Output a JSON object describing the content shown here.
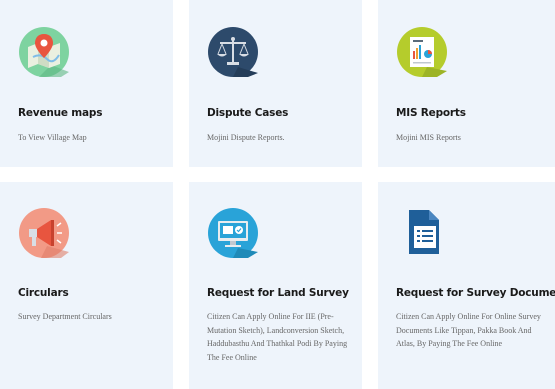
{
  "cards": [
    {
      "title": "Revenue maps",
      "description": "To View Village Map",
      "icon": "map-pin-icon"
    },
    {
      "title": "Dispute Cases",
      "description": "Mojini Dispute Reports.",
      "icon": "scales-icon"
    },
    {
      "title": "MIS Reports",
      "description": "Mojini MIS Reports",
      "icon": "report-chart-icon"
    },
    {
      "title": "Circulars",
      "description": "Survey Department Circulars",
      "icon": "megaphone-icon"
    },
    {
      "title": "Request for Land Survey",
      "description": "Citizen Can Apply Online For IIE (Pre-Mutation Sketch), Landconversion Sketch, Haddubasthu And Thathkal Podi By Paying The Fee Online",
      "icon": "monitor-check-icon"
    },
    {
      "title": "Request for Survey Documents",
      "description": "Citizen Can Apply Online For Online Survey Documents Like Tippan, Pakka Book And Atlas, By Paying The Fee Online",
      "icon": "document-icon"
    }
  ],
  "colors": {
    "card_bg": "#eef4fb",
    "icon_green": "#7ed3a0",
    "icon_navy": "#2d4a6b",
    "icon_lime": "#b5cc2c",
    "icon_peach": "#f29a86",
    "icon_blue": "#29a3d8",
    "doc_blue": "#1f5f99"
  }
}
